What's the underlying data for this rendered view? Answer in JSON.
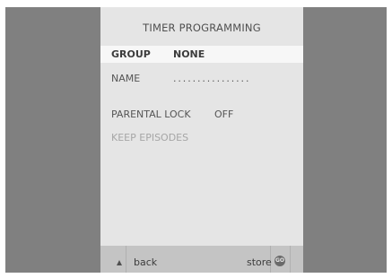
{
  "title": "TIMER PROGRAMMING",
  "rows": [
    {
      "label": "GROUP",
      "value": "NONE"
    },
    {
      "label": "NAME",
      "value": "................"
    },
    {
      "label": "PARENTAL LOCK",
      "value": "OFF"
    },
    {
      "label": "KEEP EPISODES",
      "value": ""
    }
  ],
  "footer": {
    "back_label": "back",
    "store_label": "store",
    "go_label": "GO"
  }
}
